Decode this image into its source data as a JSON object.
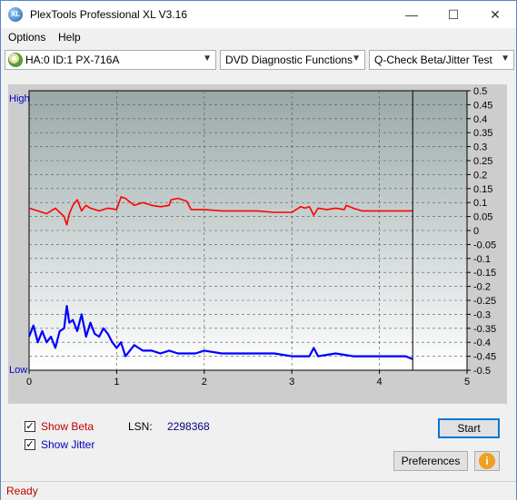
{
  "window": {
    "title": "PlexTools Professional XL V3.16",
    "icon": "XL"
  },
  "menu": [
    {
      "label": "Options"
    },
    {
      "label": "Help"
    }
  ],
  "toolbar": {
    "drive": "HA:0 ID:1  PX-716A",
    "function": "DVD Diagnostic Functions",
    "test": "Q-Check Beta/Jitter Test"
  },
  "chart_data": {
    "type": "line",
    "y_left_labels": {
      "high": "High",
      "low": "Low"
    },
    "x_ticks": [
      "0",
      "1",
      "2",
      "3",
      "4",
      "5"
    ],
    "xlim": [
      0,
      5
    ],
    "y_ticks": [
      "0.5",
      "0.45",
      "0.4",
      "0.35",
      "0.3",
      "0.25",
      "0.2",
      "0.15",
      "0.1",
      "0.05",
      "0",
      "-0.05",
      "-0.1",
      "-0.15",
      "-0.2",
      "-0.25",
      "-0.3",
      "-0.35",
      "-0.4",
      "-0.45",
      "-0.5"
    ],
    "ylim": [
      -0.5,
      0.5
    ],
    "grid": true,
    "end_marker_x": 4.38,
    "series": [
      {
        "color": "#ff0000",
        "x": [
          0.0,
          0.1,
          0.2,
          0.3,
          0.35,
          0.4,
          0.43,
          0.46,
          0.5,
          0.55,
          0.6,
          0.65,
          0.7,
          0.75,
          0.8,
          0.9,
          1.0,
          1.05,
          1.1,
          1.2,
          1.3,
          1.4,
          1.5,
          1.6,
          1.62,
          1.7,
          1.75,
          1.8,
          1.85,
          1.9,
          2.0,
          2.2,
          2.4,
          2.6,
          2.8,
          3.0,
          3.1,
          3.15,
          3.2,
          3.25,
          3.3,
          3.4,
          3.5,
          3.6,
          3.62,
          3.7,
          3.75,
          3.8,
          3.9,
          4.0,
          4.2,
          4.38
        ],
        "y": [
          0.08,
          0.07,
          0.06,
          0.08,
          0.065,
          0.05,
          0.02,
          0.06,
          0.09,
          0.11,
          0.07,
          0.09,
          0.08,
          0.075,
          0.07,
          0.08,
          0.075,
          0.12,
          0.115,
          0.09,
          0.1,
          0.09,
          0.085,
          0.09,
          0.11,
          0.115,
          0.11,
          0.105,
          0.075,
          0.075,
          0.075,
          0.07,
          0.07,
          0.07,
          0.065,
          0.065,
          0.085,
          0.08,
          0.085,
          0.055,
          0.08,
          0.075,
          0.08,
          0.075,
          0.09,
          0.08,
          0.075,
          0.07,
          0.07,
          0.07,
          0.07,
          0.07
        ]
      },
      {
        "color": "#0000ff",
        "x": [
          0.0,
          0.05,
          0.1,
          0.15,
          0.2,
          0.25,
          0.3,
          0.35,
          0.4,
          0.43,
          0.46,
          0.5,
          0.55,
          0.6,
          0.65,
          0.7,
          0.75,
          0.8,
          0.85,
          0.9,
          0.95,
          1.0,
          1.05,
          1.1,
          1.15,
          1.2,
          1.3,
          1.4,
          1.5,
          1.6,
          1.7,
          1.8,
          1.9,
          2.0,
          2.2,
          2.4,
          2.6,
          2.8,
          3.0,
          3.2,
          3.25,
          3.3,
          3.5,
          3.7,
          3.9,
          4.1,
          4.3,
          4.38
        ],
        "y": [
          -0.38,
          -0.34,
          -0.4,
          -0.36,
          -0.4,
          -0.38,
          -0.42,
          -0.36,
          -0.35,
          -0.27,
          -0.33,
          -0.32,
          -0.36,
          -0.3,
          -0.38,
          -0.33,
          -0.37,
          -0.38,
          -0.35,
          -0.37,
          -0.4,
          -0.42,
          -0.4,
          -0.45,
          -0.43,
          -0.41,
          -0.43,
          -0.43,
          -0.44,
          -0.43,
          -0.44,
          -0.44,
          -0.44,
          -0.43,
          -0.44,
          -0.44,
          -0.44,
          -0.44,
          -0.45,
          -0.45,
          -0.42,
          -0.45,
          -0.44,
          -0.45,
          -0.45,
          -0.45,
          -0.45,
          -0.46
        ]
      }
    ]
  },
  "controls": {
    "show_beta": {
      "label": "Show Beta",
      "checked": true,
      "color": "#c00000"
    },
    "show_jitter": {
      "label": "Show Jitter",
      "checked": true,
      "color": "#0000c0"
    },
    "lsn_label": "LSN:",
    "lsn_value": "2298368",
    "start_label": "Start",
    "preferences_label": "Preferences"
  },
  "status": {
    "text": "Ready"
  }
}
